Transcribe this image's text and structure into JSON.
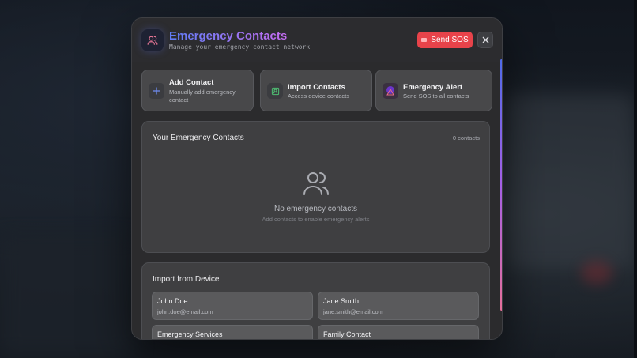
{
  "modal": {
    "title": "Emergency Contacts",
    "subtitle": "Manage your emergency contact network",
    "sos_label": "Send SOS",
    "close_icon": "close-icon",
    "header_icon": "users-icon"
  },
  "actions": [
    {
      "title": "Add Contact",
      "desc_line1": "Manually add emergency",
      "desc_line2": "contact",
      "icon": "plus-icon"
    },
    {
      "title": "Import Contacts",
      "desc_line1": "Access device contacts",
      "icon": "contact-card-icon"
    },
    {
      "title": "Emergency Alert",
      "desc_line1": "Send SOS to all contacts",
      "icon": "alert-icon"
    }
  ],
  "contacts_panel": {
    "title": "Your Emergency Contacts",
    "count": "0 contacts",
    "empty_title": "No emergency contacts",
    "empty_sub": "Add contacts to enable emergency alerts",
    "empty_icon": "users-icon"
  },
  "import_panel": {
    "title": "Import from Device",
    "contacts": [
      {
        "name": "John Doe",
        "email": "john.doe@email.com"
      },
      {
        "name": "Jane Smith",
        "email": "jane.smith@email.com"
      },
      {
        "name": "Emergency Services",
        "email": ""
      },
      {
        "name": "Family Contact",
        "email": ""
      }
    ]
  },
  "colors": {
    "accent_blue": "#5f7df5",
    "accent_purple": "#c46cf0",
    "sos_red": "#e8434a"
  }
}
